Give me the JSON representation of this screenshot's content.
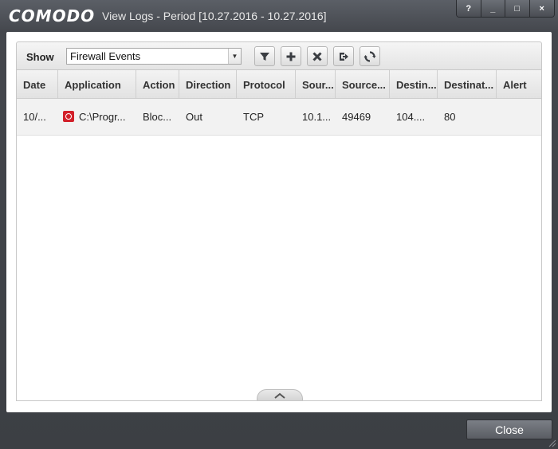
{
  "window": {
    "brand": "COMODO",
    "title": "View Logs - Period [10.27.2016 - 10.27.2016]",
    "controls": {
      "help": "?",
      "minimize": "_",
      "maximize": "□",
      "close": "×"
    }
  },
  "toolbar": {
    "show_label": "Show",
    "selected_log": "Firewall Events",
    "buttons": [
      "filter-icon",
      "add-icon",
      "delete-icon",
      "export-icon",
      "refresh-icon"
    ]
  },
  "table": {
    "columns": [
      "Date",
      "Application",
      "Action",
      "Direction",
      "Protocol",
      "Sour...",
      "Source...",
      "Destin...",
      "Destinat...",
      "Alert"
    ],
    "rows": [
      [
        "10/...",
        "C:\\Progr...",
        "Bloc...",
        "Out",
        "TCP",
        "10.1...",
        "49469",
        "104....",
        "80",
        ""
      ]
    ]
  },
  "footer": {
    "close_label": "Close"
  },
  "colors": {
    "accent_red": "#d2202a",
    "chrome_dark": "#3c3f44"
  }
}
